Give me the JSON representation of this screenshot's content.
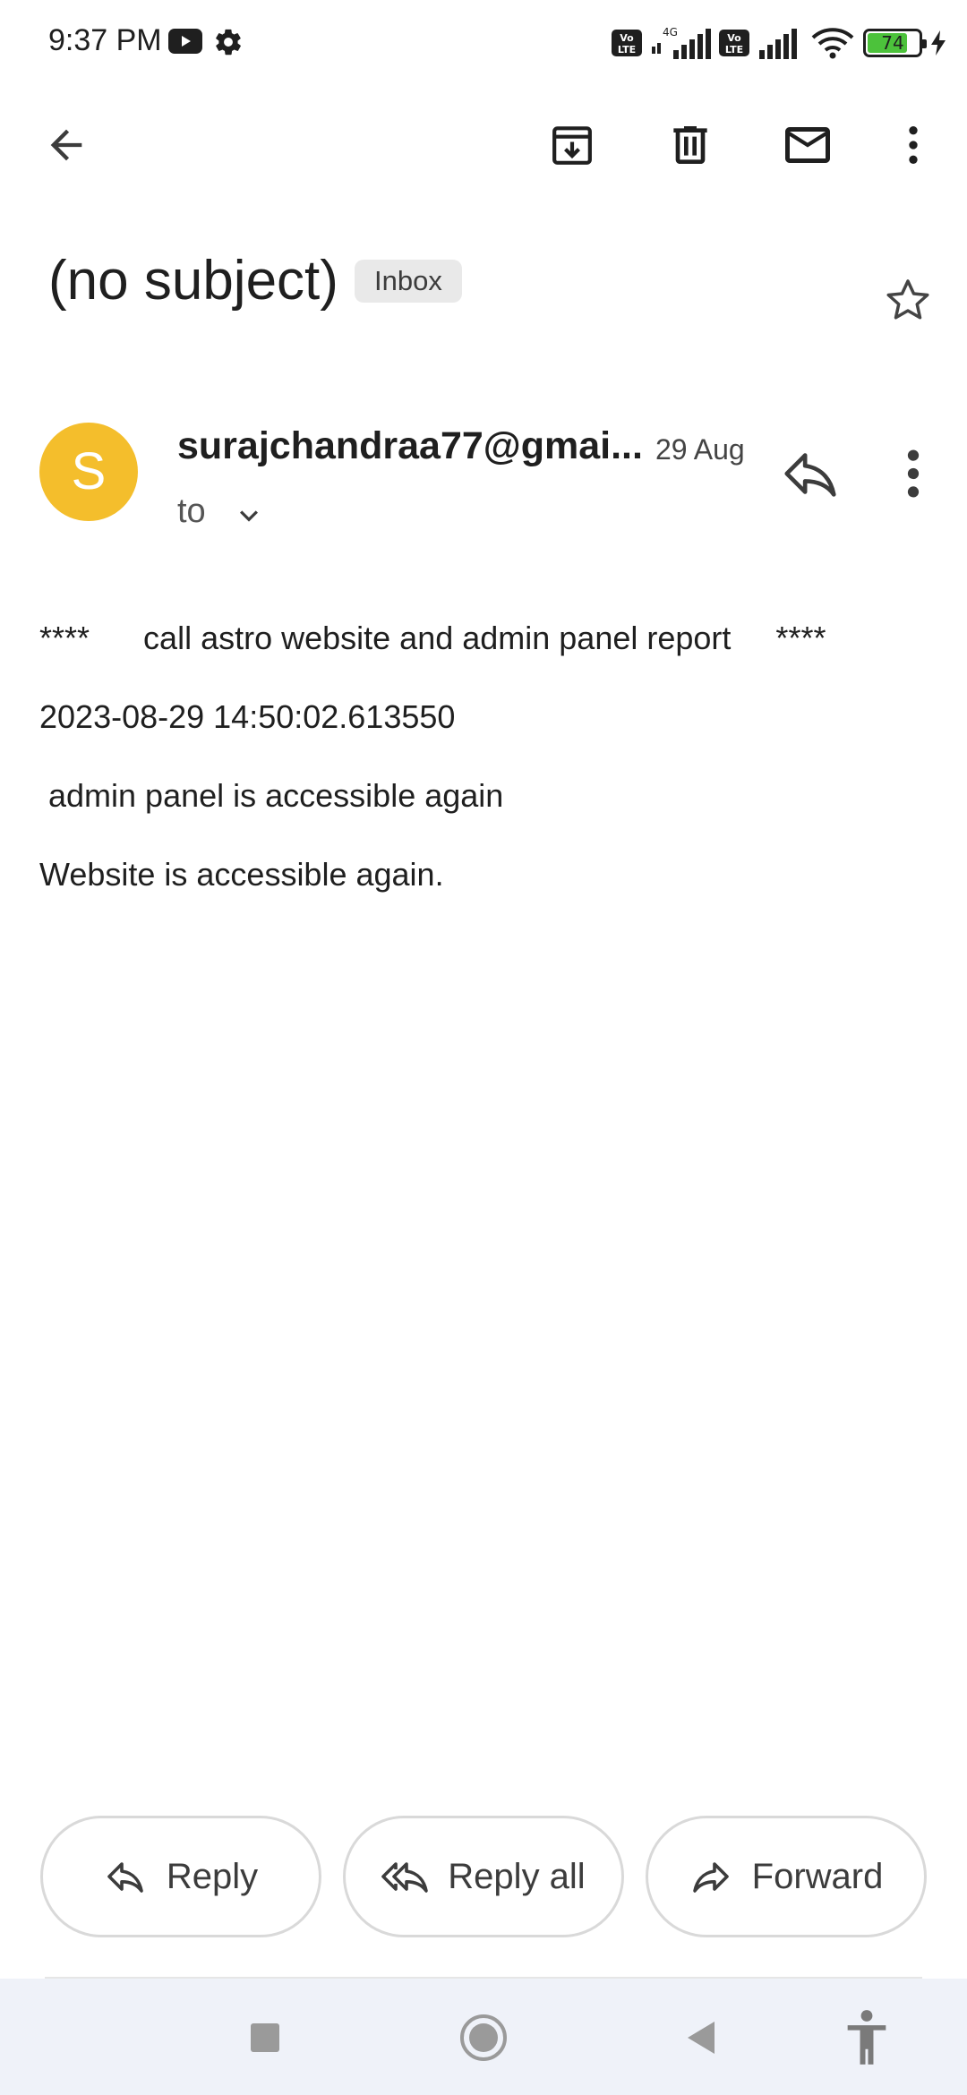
{
  "status_bar": {
    "time": "9:37 PM",
    "battery": "74",
    "network_type": "4G",
    "volte_label": "Vo LTE"
  },
  "toolbar": {
    "icons": [
      "back-arrow-icon",
      "archive-icon",
      "delete-icon",
      "mark-unread-icon",
      "more-vert-icon"
    ]
  },
  "email": {
    "subject": "(no subject)",
    "label": "Inbox",
    "sender_initial": "S",
    "sender": "surajchandraa77@gmai...",
    "date": "29 Aug",
    "to_label": "to",
    "avatar_color": "#f4be2c",
    "body_lines": [
      "****      call astro website and admin panel report     ****",
      "2023-08-29 14:50:02.613550",
      " admin panel is accessible again",
      "Website is accessible again."
    ]
  },
  "actions": {
    "reply": "Reply",
    "reply_all": "Reply all",
    "forward": "Forward"
  },
  "nav_bar": {
    "icons": [
      "recents-icon",
      "home-icon",
      "back-icon",
      "accessibility-icon"
    ]
  }
}
